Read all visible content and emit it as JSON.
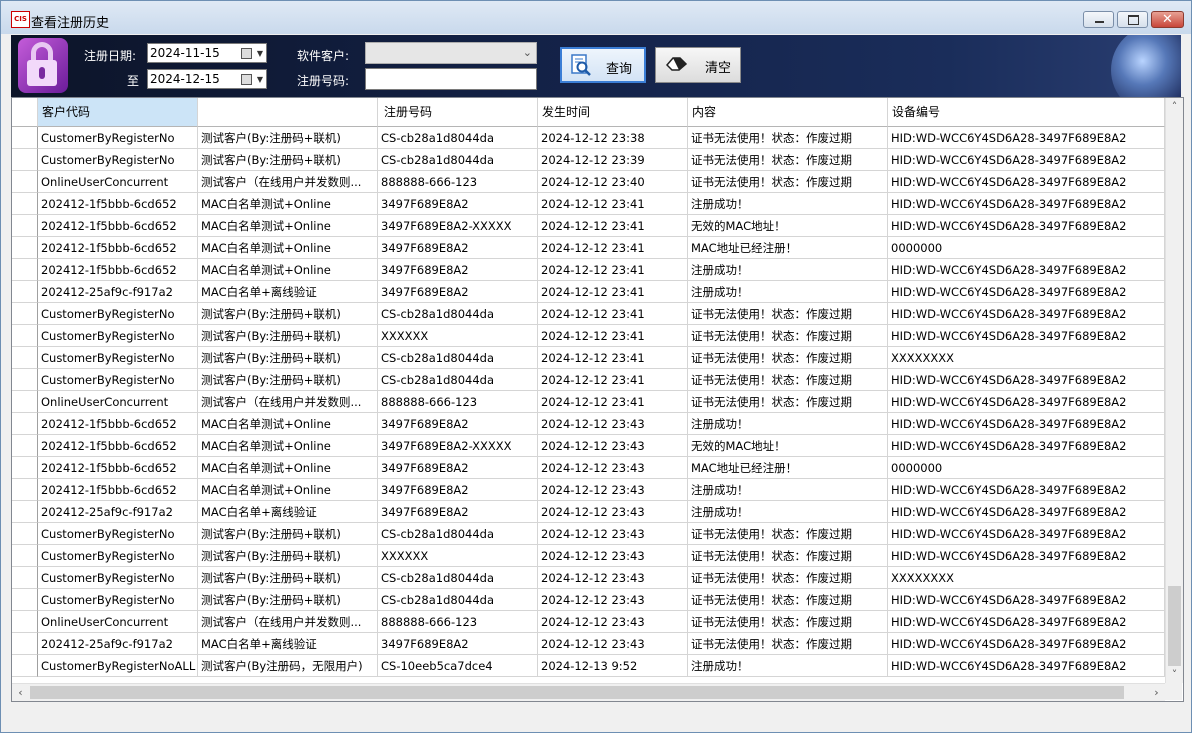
{
  "window": {
    "title": "查看注册历史",
    "icon_text": "CIS"
  },
  "filters": {
    "reg_date_label": "注册日期:",
    "to_label": "至",
    "date_from": "2024-11-15",
    "date_to": "2024-12-15",
    "customer_label": "软件客户:",
    "customer_value": "",
    "regcode_label": "注册号码:",
    "regcode_value": ""
  },
  "buttons": {
    "query": "查询",
    "clear": "清空"
  },
  "table": {
    "headers": [
      "客户代码",
      "",
      "注册号码",
      "发生时间",
      "内容",
      "设备编号"
    ],
    "rows": [
      [
        "CustomerByRegisterNo",
        "测试客户(By:注册码+联机)",
        "CS-cb28a1d8044da",
        "2024-12-12 23:38",
        "证书无法使用！状态：作废过期",
        "HID:WD-WCC6Y4SD6A28-3497F689E8A2"
      ],
      [
        "CustomerByRegisterNo",
        "测试客户(By:注册码+联机)",
        "CS-cb28a1d8044da",
        "2024-12-12 23:39",
        "证书无法使用！状态：作废过期",
        "HID:WD-WCC6Y4SD6A28-3497F689E8A2"
      ],
      [
        "OnlineUserConcurrent",
        "测试客户（在线用户并发数则...",
        "888888-666-123",
        "2024-12-12 23:40",
        "证书无法使用！状态：作废过期",
        "HID:WD-WCC6Y4SD6A28-3497F689E8A2"
      ],
      [
        "202412-1f5bbb-6cd652",
        "MAC白名单测试+Online",
        "3497F689E8A2",
        "2024-12-12 23:41",
        "注册成功！",
        "HID:WD-WCC6Y4SD6A28-3497F689E8A2"
      ],
      [
        "202412-1f5bbb-6cd652",
        "MAC白名单测试+Online",
        "3497F689E8A2-XXXXX",
        "2024-12-12 23:41",
        "无效的MAC地址！",
        "HID:WD-WCC6Y4SD6A28-3497F689E8A2"
      ],
      [
        "202412-1f5bbb-6cd652",
        "MAC白名单测试+Online",
        "3497F689E8A2",
        "2024-12-12 23:41",
        "MAC地址已经注册！",
        "0000000"
      ],
      [
        "202412-1f5bbb-6cd652",
        "MAC白名单测试+Online",
        "3497F689E8A2",
        "2024-12-12 23:41",
        "注册成功！",
        "HID:WD-WCC6Y4SD6A28-3497F689E8A2"
      ],
      [
        "202412-25af9c-f917a2",
        "MAC白名单+离线验证",
        "3497F689E8A2",
        "2024-12-12 23:41",
        "注册成功！",
        "HID:WD-WCC6Y4SD6A28-3497F689E8A2"
      ],
      [
        "CustomerByRegisterNo",
        "测试客户(By:注册码+联机)",
        "CS-cb28a1d8044da",
        "2024-12-12 23:41",
        "证书无法使用！状态：作废过期",
        "HID:WD-WCC6Y4SD6A28-3497F689E8A2"
      ],
      [
        "CustomerByRegisterNo",
        "测试客户(By:注册码+联机)",
        "XXXXXX",
        "2024-12-12 23:41",
        "证书无法使用！状态：作废过期",
        "HID:WD-WCC6Y4SD6A28-3497F689E8A2"
      ],
      [
        "CustomerByRegisterNo",
        "测试客户(By:注册码+联机)",
        "CS-cb28a1d8044da",
        "2024-12-12 23:41",
        "证书无法使用！状态：作废过期",
        "XXXXXXXX"
      ],
      [
        "CustomerByRegisterNo",
        "测试客户(By:注册码+联机)",
        "CS-cb28a1d8044da",
        "2024-12-12 23:41",
        "证书无法使用！状态：作废过期",
        "HID:WD-WCC6Y4SD6A28-3497F689E8A2"
      ],
      [
        "OnlineUserConcurrent",
        "测试客户（在线用户并发数则...",
        "888888-666-123",
        "2024-12-12 23:41",
        "证书无法使用！状态：作废过期",
        "HID:WD-WCC6Y4SD6A28-3497F689E8A2"
      ],
      [
        "202412-1f5bbb-6cd652",
        "MAC白名单测试+Online",
        "3497F689E8A2",
        "2024-12-12 23:43",
        "注册成功！",
        "HID:WD-WCC6Y4SD6A28-3497F689E8A2"
      ],
      [
        "202412-1f5bbb-6cd652",
        "MAC白名单测试+Online",
        "3497F689E8A2-XXXXX",
        "2024-12-12 23:43",
        "无效的MAC地址！",
        "HID:WD-WCC6Y4SD6A28-3497F689E8A2"
      ],
      [
        "202412-1f5bbb-6cd652",
        "MAC白名单测试+Online",
        "3497F689E8A2",
        "2024-12-12 23:43",
        "MAC地址已经注册！",
        "0000000"
      ],
      [
        "202412-1f5bbb-6cd652",
        "MAC白名单测试+Online",
        "3497F689E8A2",
        "2024-12-12 23:43",
        "注册成功！",
        "HID:WD-WCC6Y4SD6A28-3497F689E8A2"
      ],
      [
        "202412-25af9c-f917a2",
        "MAC白名单+离线验证",
        "3497F689E8A2",
        "2024-12-12 23:43",
        "注册成功！",
        "HID:WD-WCC6Y4SD6A28-3497F689E8A2"
      ],
      [
        "CustomerByRegisterNo",
        "测试客户(By:注册码+联机)",
        "CS-cb28a1d8044da",
        "2024-12-12 23:43",
        "证书无法使用！状态：作废过期",
        "HID:WD-WCC6Y4SD6A28-3497F689E8A2"
      ],
      [
        "CustomerByRegisterNo",
        "测试客户(By:注册码+联机)",
        "XXXXXX",
        "2024-12-12 23:43",
        "证书无法使用！状态：作废过期",
        "HID:WD-WCC6Y4SD6A28-3497F689E8A2"
      ],
      [
        "CustomerByRegisterNo",
        "测试客户(By:注册码+联机)",
        "CS-cb28a1d8044da",
        "2024-12-12 23:43",
        "证书无法使用！状态：作废过期",
        "XXXXXXXX"
      ],
      [
        "CustomerByRegisterNo",
        "测试客户(By:注册码+联机)",
        "CS-cb28a1d8044da",
        "2024-12-12 23:43",
        "证书无法使用！状态：作废过期",
        "HID:WD-WCC6Y4SD6A28-3497F689E8A2"
      ],
      [
        "OnlineUserConcurrent",
        "测试客户（在线用户并发数则...",
        "888888-666-123",
        "2024-12-12 23:43",
        "证书无法使用！状态：作废过期",
        "HID:WD-WCC6Y4SD6A28-3497F689E8A2"
      ],
      [
        "202412-25af9c-f917a2",
        "MAC白名单+离线验证",
        "3497F689E8A2",
        "2024-12-12 23:43",
        "证书无法使用！状态：作废过期",
        "HID:WD-WCC6Y4SD6A28-3497F689E8A2"
      ],
      [
        "CustomerByRegisterNoALL",
        "测试客户(By注册码，无限用户)",
        "CS-10eeb5ca7dce4",
        "2024-12-13 9:52",
        "注册成功！",
        "HID:WD-WCC6Y4SD6A28-3497F689E8A2"
      ]
    ]
  },
  "icons": {
    "lock": "lock-icon",
    "search": "search-doc-icon",
    "eraser": "eraser-icon",
    "calendar": "calendar-icon"
  }
}
